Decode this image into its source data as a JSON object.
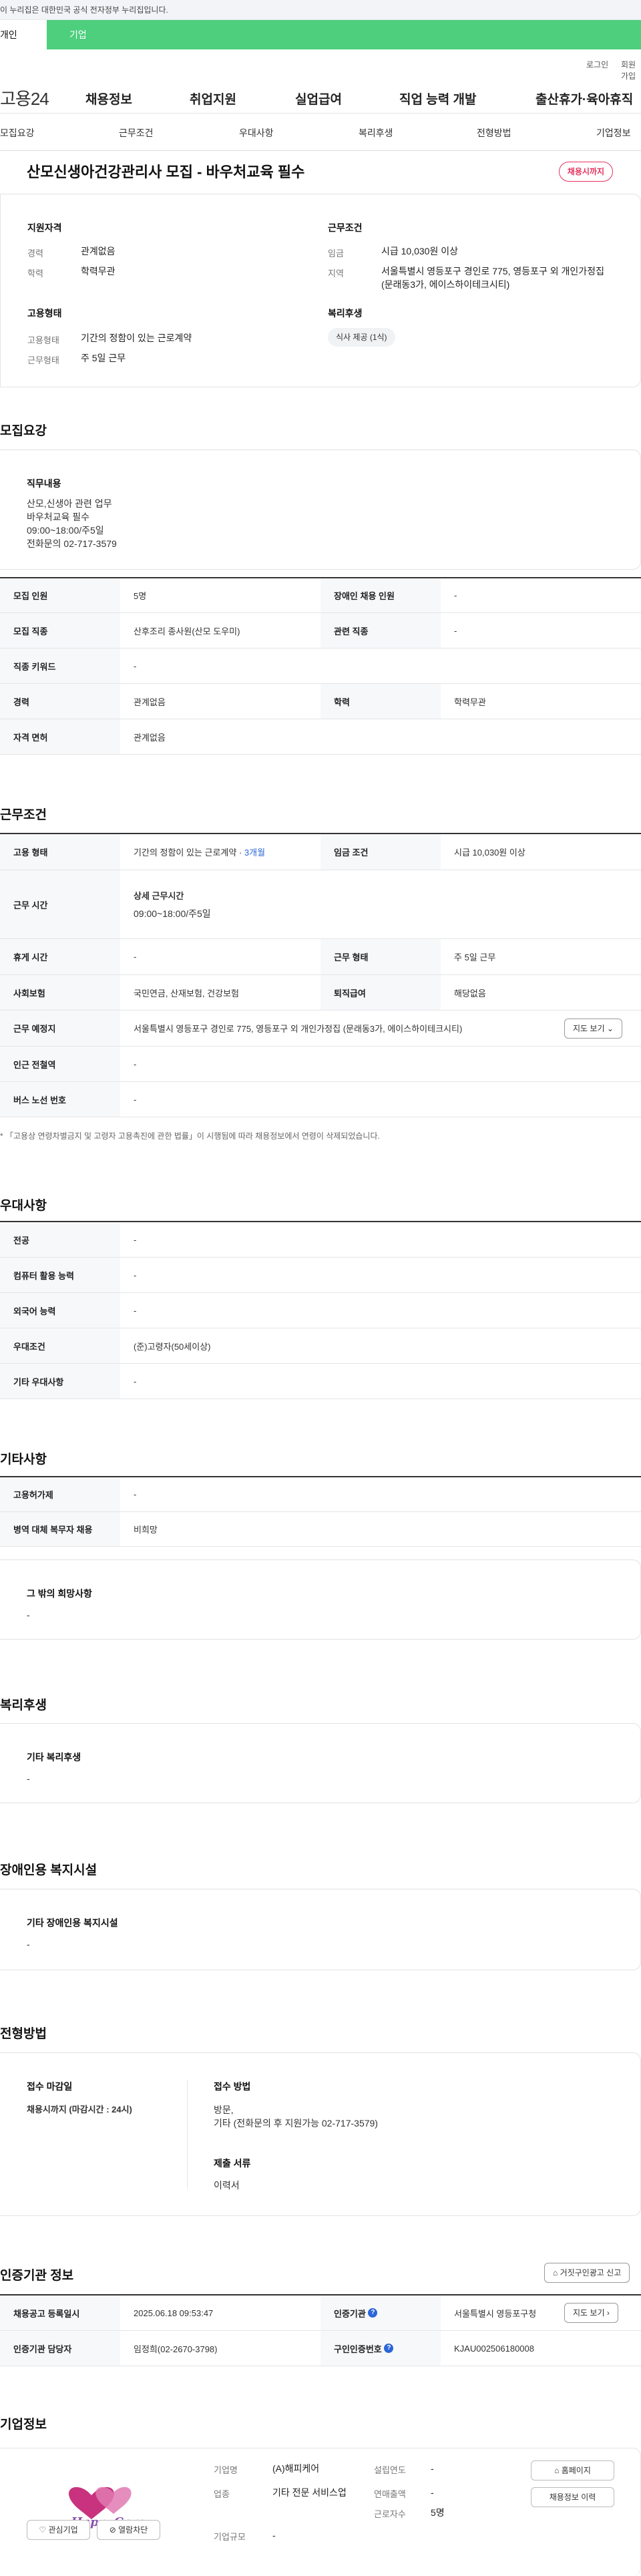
{
  "gov_banner": "이 누리집은 대한민국 공식 전자정부 누리집입니다.",
  "usertype": {
    "personal": "개인",
    "company": "기업"
  },
  "util": {
    "login": "로그인",
    "signup": "회원가입"
  },
  "gnb": {
    "logo": "고용24",
    "menu": [
      "채용정보",
      "취업지원",
      "실업급여",
      "직업 능력 개발",
      "출산휴가·육아휴직"
    ]
  },
  "anchors": [
    "모집요강",
    "근무조건",
    "우대사항",
    "복리후생",
    "전형방법",
    "기업정보"
  ],
  "job": {
    "title": "산모신생아건강관리사 모집 - 바우처교육 필수",
    "deadline_pill": "채용시까지"
  },
  "summary": {
    "qual_head": "지원자격",
    "qual": [
      {
        "label": "경력",
        "value": "관계없음"
      },
      {
        "label": "학력",
        "value": "학력무관"
      }
    ],
    "cond_head": "근무조건",
    "cond": [
      {
        "label": "임금",
        "value": "시급 10,030원 이상"
      },
      {
        "label": "지역",
        "value": "서울특별시 영등포구 경인로 775, 영등포구 외 개인가정집 (문래동3가, 에이스하이테크시티)"
      }
    ],
    "emp_head": "고용형태",
    "emp": [
      {
        "label": "고용형태",
        "value": "기간의 정함이 있는 근로계약"
      },
      {
        "label": "근무형태",
        "value": "주 5일 근무"
      }
    ],
    "welfare_head": "복리후생",
    "welfare_chip": "식사 제공 (1식)"
  },
  "recruit": {
    "heading": "모집요강",
    "duty_title": "직무내용",
    "duty_body": "산모,신생아 관련 업무\n바우처교육 필수\n09:00~18:00/주5일\n전화문의 02-717-3579",
    "rows": [
      {
        "h1": "모집 인원",
        "v1": "5명",
        "h2": "장애인 채용 인원",
        "v2": "-"
      },
      {
        "h1": "모집 직종",
        "v1": "산후조리 종사원(산모 도우미)",
        "h2": "관련 직종",
        "v2": "-"
      },
      {
        "h1": "직종 키워드",
        "v1": "-"
      },
      {
        "h1": "경력",
        "v1": "관계없음",
        "h2": "학력",
        "v2": "학력무관"
      },
      {
        "h1": "자격 면허",
        "v1": "관계없음"
      }
    ]
  },
  "work": {
    "heading": "근무조건",
    "emp_type_label": "고용 형태",
    "emp_type_value": "기간의 정함이 있는 근로계약 ·",
    "emp_type_months": "3개월",
    "wage_label": "임금 조건",
    "wage_value": "시급 10,030원 이상",
    "hours_label": "근무 시간",
    "hours_sub": "상세 근무시간",
    "hours_value": "09:00~18:00/주5일",
    "rows": [
      {
        "h1": "휴게 시간",
        "v1": "-",
        "h2": "근무 형태",
        "v2": "주 5일 근무"
      },
      {
        "h1": "사회보험",
        "v1": "국민연금, 산재보험, 건강보험",
        "h2": "퇴직급여",
        "v2": "해당없음"
      }
    ],
    "place_label": "근무 예정지",
    "place_value": "서울특별시 영등포구 경인로 775, 영등포구 외 개인가정집 (문래동3가, 에이스하이테크시티)",
    "map_button": "지도 보기",
    "station_label": "인근 전철역",
    "station_value": "-",
    "bus_label": "버스 노선 번호",
    "bus_value": "-",
    "note": "「고용상 연령차별금지 및 고령자 고용촉진에 관한 법률」이 시행됨에 따라 채용정보에서 연령이 삭제되었습니다."
  },
  "pref": {
    "heading": "우대사항",
    "rows": [
      {
        "h": "전공",
        "v": "-"
      },
      {
        "h": "컴퓨터 활용 능력",
        "v": "-"
      },
      {
        "h": "외국어 능력",
        "v": "-"
      },
      {
        "h": "우대조건",
        "v": "(준)고령자(50세이상)"
      },
      {
        "h": "기타 우대사항",
        "v": "-"
      }
    ]
  },
  "etc": {
    "heading": "기타사항",
    "rows": [
      {
        "h": "고용허가제",
        "v": "-"
      },
      {
        "h": "병역 대체 복무자 채용",
        "v": "비희망"
      }
    ],
    "other_title": "그 밖의 희망사항",
    "other_value": "-"
  },
  "welfare": {
    "heading": "복리후생",
    "title": "기타 복리후생",
    "value": "-"
  },
  "disab": {
    "heading": "장애인용 복지시설",
    "title": "기타 장애인용 복지시설",
    "value": "-"
  },
  "selection": {
    "heading": "전형방법",
    "deadline_title": "접수 마감일",
    "deadline_value": "채용시까지 (마감시간 : 24시)",
    "method_title": "접수 방법",
    "method_value": "방문,\n기타 (전화문의 후 지원가능 02-717-3579)",
    "docs_title": "제출 서류",
    "docs_value": "이력서"
  },
  "cert": {
    "heading": "인증기관 정보",
    "report_button": "거짓구인광고 신고",
    "row1": {
      "h1": "채용공고 등록일시",
      "v1": "2025.06.18 09:53:47",
      "h2": "인증기관",
      "v2": "서울특별시 영등포구청",
      "btn": "지도 보기"
    },
    "row2": {
      "h1": "인증기관 담당자",
      "v1": "임정희(02-2670-3798)",
      "h2": "구인인증번호",
      "v2": "KJAU002506180008"
    }
  },
  "company": {
    "heading": "기업정보",
    "logo_text": "HappyCare",
    "interest_button": "관심기업",
    "block_button": "열람차단",
    "name_label": "기업명",
    "name_value": "(A)해피케어",
    "biz_label": "업종",
    "biz_value": "기타 전문 서비스업",
    "size_label": "기업규모",
    "size_value": "-",
    "est_label": "설립연도",
    "est_value": "-",
    "sales_label": "연매출액",
    "sales_value": "-",
    "emp_label": "근로자수",
    "emp_value": "5명",
    "homepage_button": "홈페이지",
    "jobs_button": "채용정보 이력"
  },
  "colors": {
    "accent_green": "#4dcf7e",
    "deadline_red": "#e5335e",
    "link_blue": "#2b66d9"
  }
}
